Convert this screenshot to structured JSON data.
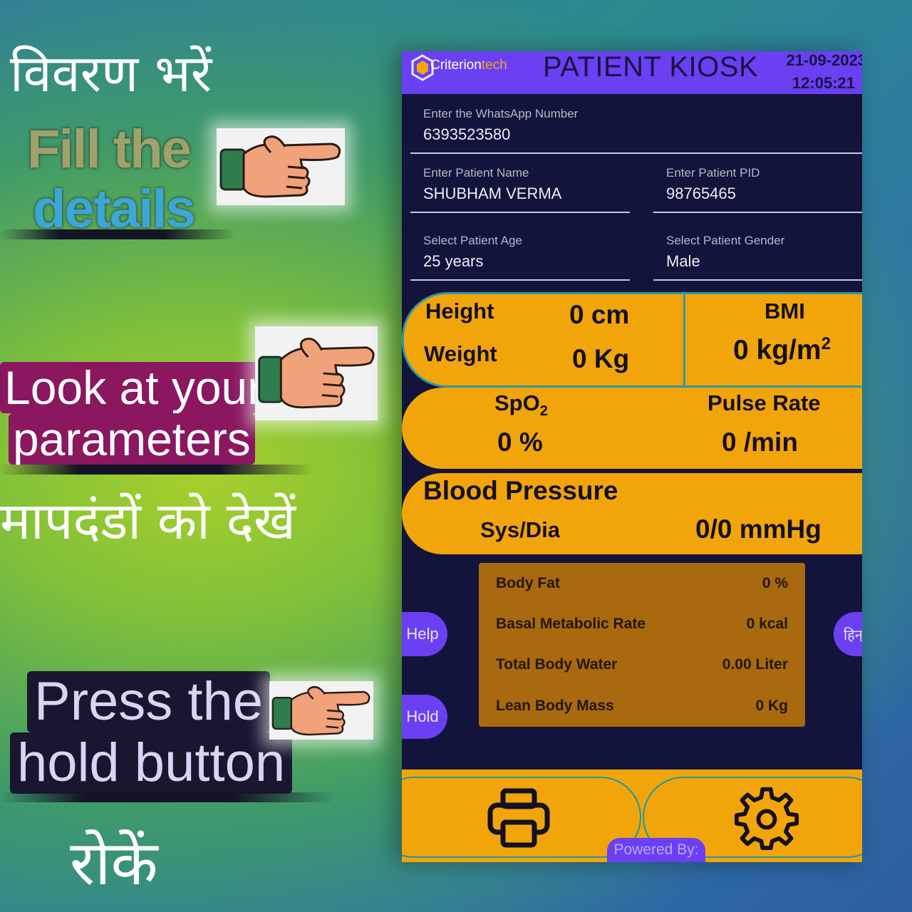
{
  "captions": {
    "hindi_fill": "विवरण भरें",
    "fill_line1": "Fill the",
    "fill_line2": "details",
    "look_line1": "Look at your",
    "look_line2": "parameters",
    "hindi_look": "मापदंडों को देखें",
    "press_line1": "Press the",
    "press_line2": "hold button",
    "hindi_hold": "रोकें"
  },
  "icons": {
    "pointer": "pointing-hand-icon",
    "printer": "printer-icon",
    "settings": "gear-icon",
    "logo": "criteriontech-logo-icon"
  },
  "header": {
    "brand_part1": "Criterion",
    "brand_part2": "tech",
    "title": "PATIENT KIOSK",
    "date": "21-09-2023",
    "time": "12:05:21"
  },
  "form": {
    "whatsapp": {
      "label": "Enter the WhatsApp Number",
      "value": "6393523580"
    },
    "name": {
      "label": "Enter Patient Name",
      "value": "SHUBHAM VERMA"
    },
    "pid": {
      "label": "Enter Patient PID",
      "value": "98765465"
    },
    "age": {
      "label": "Select Patient Age",
      "value": "25 years"
    },
    "gender": {
      "label": "Select Patient Gender",
      "value": "Male"
    }
  },
  "vitals": {
    "height_label": "Height",
    "height_value": "0 cm",
    "weight_label": "Weight",
    "weight_value": "0 Kg",
    "bmi_label": "BMI",
    "bmi_value": "0 kg/m",
    "bmi_exp": "2",
    "spo2_label": "SpO",
    "spo2_sub": "2",
    "spo2_value": "0 %",
    "pulse_label": "Pulse Rate",
    "pulse_value": "0 /min",
    "bp_label": "Blood Pressure",
    "bp_sub_label": "Sys/Dia",
    "bp_value": "0/0 mmHg"
  },
  "body_composition": [
    {
      "label": "Body Fat",
      "value": "0 %"
    },
    {
      "label": "Basal Metabolic Rate",
      "value": "0 kcal"
    },
    {
      "label": "Total Body Water",
      "value": "0.00 Liter"
    },
    {
      "label": "Lean Body Mass",
      "value": "0 Kg"
    }
  ],
  "side_buttons": {
    "help": "Help",
    "hold": "Hold",
    "language": "हिन्"
  },
  "footer": {
    "powered_by": "Powered By:"
  },
  "colors": {
    "header_purple": "#6a40f2",
    "panel_navy": "#12143c",
    "vital_orange": "#f2a50b",
    "body_box_brown": "#a8690f"
  }
}
